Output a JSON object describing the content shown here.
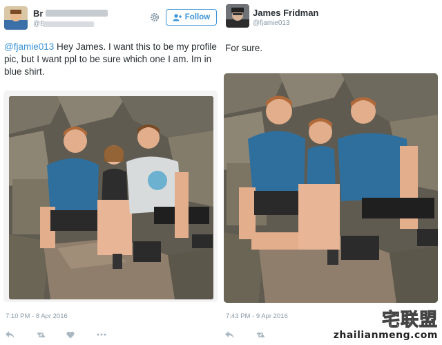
{
  "left_tweet": {
    "author_name": "Br",
    "author_handle": "@B",
    "follow_label": "Follow",
    "mention": "@fjamie013",
    "text": " Hey James. I want this to be my profile pic, but I want ppl to be sure which one I am. Im in blue shirt.",
    "timestamp": "7:10 PM - 8 Apr 2016"
  },
  "right_tweet": {
    "author_name": "James Fridman",
    "author_handle": "@fjamie013",
    "text": "For sure.",
    "timestamp": "7:43 PM - 9 Apr 2016"
  },
  "watermark": {
    "logo": "宅联盟",
    "url": "zhailianmeng.com"
  },
  "icons": [
    "gear-icon",
    "follow-person-icon",
    "reply-icon",
    "retweet-icon",
    "like-icon",
    "more-icon"
  ],
  "colors": {
    "link": "#3b94d9",
    "muted": "#8899a6",
    "text": "#292f33"
  }
}
